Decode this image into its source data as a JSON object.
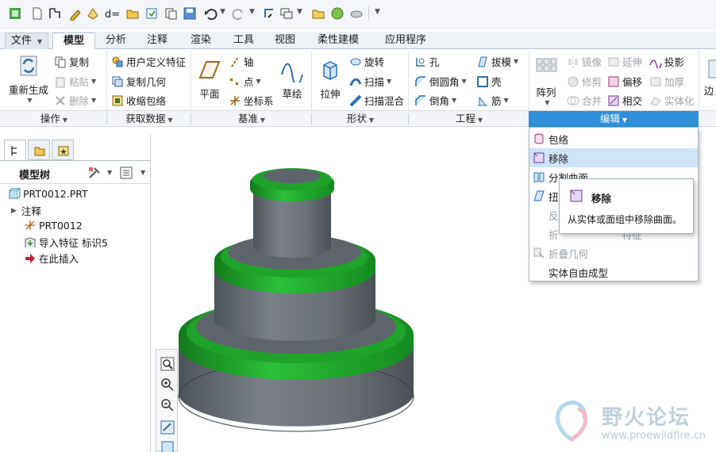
{
  "quick_access": {
    "icons": [
      "app-icon",
      "new-file-icon",
      "open-icon",
      "open-recent-icon",
      "regenerate-icon",
      "parameters-icon",
      "folder-open-icon",
      "save-as-icon",
      "copy-icon",
      "save-icon",
      "undo-icon",
      "redo-icon",
      "regen-icon",
      "windows-icon",
      "folder-icon",
      "appearance-icon",
      "display-style-icon",
      "more-icon"
    ]
  },
  "tabs": [
    "文件",
    "模型",
    "分析",
    "注释",
    "渲染",
    "工具",
    "视图",
    "柔性建模",
    "应用程序"
  ],
  "active_tab": "模型",
  "ribbon": {
    "regenerate": "重新生成",
    "copy": "复制",
    "paste": "粘贴",
    "delete": "删除",
    "udf": "用户定义特征",
    "copy_geom": "复制几何",
    "shrinkwrap": "收缩包络",
    "plane": "平面",
    "axis": "轴",
    "point": "点",
    "csys": "坐标系",
    "sketch": "草绘",
    "extrude": "拉伸",
    "revolve": "旋转",
    "sweep": "扫描",
    "swept_blend": "扫描混合",
    "hole": "孔",
    "round": "倒圆角",
    "chamfer": "倒角",
    "draft": "拔模",
    "shell": "壳",
    "rib": "筋",
    "pattern": "阵列",
    "mirror": "镜像",
    "trim": "修剪",
    "merge": "合并",
    "extend": "延伸",
    "offset": "偏移",
    "intersect": "相交",
    "project": "投影",
    "thicken": "加厚",
    "solidify": "实体化",
    "cut_off": "边"
  },
  "groups": [
    "操作",
    "获取数据",
    "基准",
    "形状",
    "工程",
    "编辑"
  ],
  "active_group": "编辑",
  "panel": {
    "title": "模型树",
    "items": [
      {
        "label": "PRT0012.PRT",
        "icon": "part-icon"
      },
      {
        "label": "注释",
        "icon": "expand-arrow-icon"
      },
      {
        "label": "PRT0012",
        "icon": "csys-icon"
      },
      {
        "label": "导入特征 标识5",
        "icon": "import-feature-icon"
      },
      {
        "label": "在此插入",
        "icon": "insert-here-arrow-icon"
      }
    ]
  },
  "menu": {
    "items": [
      {
        "label": "包络",
        "icon": "wrap-icon",
        "state": "normal"
      },
      {
        "label": "移除",
        "icon": "remove-surface-icon",
        "state": "highlighted"
      },
      {
        "label": "分割曲面",
        "icon": "split-surface-icon",
        "state": "normal"
      },
      {
        "label": "扭",
        "icon": "twist-icon",
        "state": "normal"
      },
      {
        "label": "反",
        "icon": "",
        "state": "disabled"
      },
      {
        "label": "折",
        "icon": "",
        "state": "disabled"
      },
      {
        "label": "折叠几何",
        "icon": "collapse-geom-icon",
        "state": "disabled"
      },
      {
        "label": "实体自由成型",
        "icon": "",
        "state": "normal"
      }
    ],
    "partial_text": "特征"
  },
  "tooltip": {
    "title": "移除",
    "desc": "从实体或面组中移除曲面。"
  },
  "watermark": {
    "name": "野火论坛",
    "url": "www.proewildfire.cn"
  },
  "colors": {
    "accent": "#2f8fd8",
    "model_gray": "#6d7278",
    "model_green": "#1fa32a",
    "menu_highlight": "#cfe4f6"
  }
}
